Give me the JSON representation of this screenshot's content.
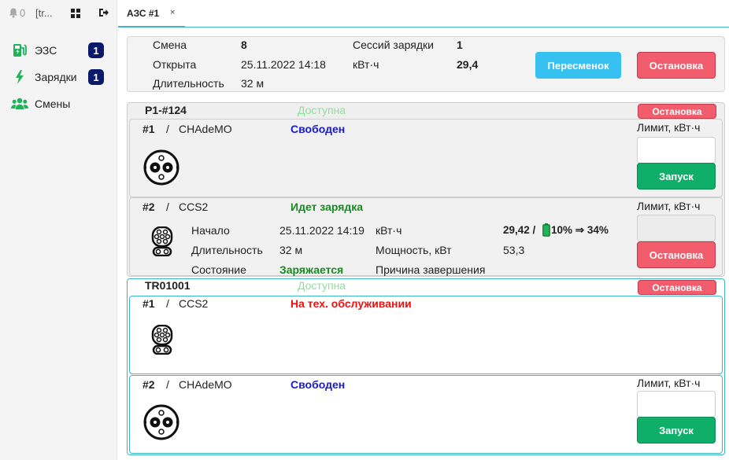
{
  "sidebar": {
    "notif_count": "0",
    "user": "[tr...",
    "items": [
      {
        "label": "ЭЗС",
        "badge": "1",
        "icon": "charging-station-icon"
      },
      {
        "label": "Зарядки",
        "badge": "1",
        "icon": "lightning-icon"
      },
      {
        "label": "Смены",
        "icon": "users-icon"
      }
    ]
  },
  "tabs": [
    {
      "label": "АЗС #1",
      "close": "×"
    }
  ],
  "shift": {
    "shift_label": "Смена",
    "shift_value": "8",
    "opened_label": "Открыта",
    "opened_value": "25.11.2022 14:18",
    "duration_label": "Длительность",
    "duration_value": "32 м",
    "sessions_label": "Сессий зарядки",
    "sessions_value": "1",
    "kwh_label": "кВт·ч",
    "kwh_value": "29,4",
    "reshift_button": "Пересменок",
    "stop_button": "Остановка"
  },
  "stations": [
    {
      "name": "P1-#124",
      "status": "Доступна",
      "stop_button": "Остановка",
      "connectors": [
        {
          "num": "#1",
          "sep": "/",
          "type": "CHAdeMO",
          "status": "Свободен",
          "limit_label": "Лимит, кВт·ч",
          "button": "Запуск"
        },
        {
          "num": "#2",
          "sep": "/",
          "type": "CCS2",
          "status": "Идет зарядка",
          "limit_label": "Лимит, кВт·ч",
          "button": "Остановка",
          "session": {
            "start_label": "Начало",
            "start_value": "25.11.2022 14:19",
            "duration_label": "Длительность",
            "duration_value": "32 м",
            "state_label": "Состояние",
            "state_value": "Заряжается",
            "kwh_label": "кВт·ч",
            "kwh_value": "29,42 /",
            "soc_value": "10% ⇒ 34%",
            "power_label": "Мощность, кВт",
            "power_value": "53,3",
            "reason_label": "Причина завершения"
          }
        }
      ]
    },
    {
      "name": "TR01001",
      "status": "Доступна",
      "stop_button": "Остановка",
      "connectors": [
        {
          "num": "#1",
          "sep": "/",
          "type": "CCS2",
          "status": "На тех. обслуживании"
        },
        {
          "num": "#2",
          "sep": "/",
          "type": "CHAdeMO",
          "status": "Свободен",
          "limit_label": "Лимит, кВт·ч",
          "button": "Запуск"
        }
      ]
    }
  ],
  "colors": {
    "accent": "#3fb6c8",
    "badge": "#0a1a6b",
    "blue_button": "#37c1f0",
    "red_button": "#f15d6c",
    "green_button": "#0fae69",
    "available": "#8fe09a"
  }
}
